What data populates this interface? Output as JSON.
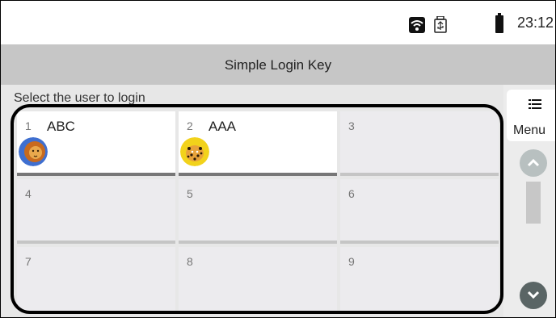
{
  "status_bar": {
    "time": "23:12",
    "wifi_icon": "wifi-icon",
    "usb_icon": "usb-icon",
    "battery_icon": "battery-icon"
  },
  "header": {
    "title": "Simple Login Key"
  },
  "instruction": "Select the user to login",
  "users": [
    {
      "number": "1",
      "name": "ABC",
      "avatar": "lion-avatar"
    },
    {
      "number": "2",
      "name": "AAA",
      "avatar": "leopard-avatar"
    },
    {
      "number": "3",
      "name": ""
    },
    {
      "number": "4",
      "name": ""
    },
    {
      "number": "5",
      "name": ""
    },
    {
      "number": "6",
      "name": ""
    },
    {
      "number": "7",
      "name": ""
    },
    {
      "number": "8",
      "name": ""
    },
    {
      "number": "9",
      "name": ""
    }
  ],
  "side_panel": {
    "menu_label": "Menu",
    "menu_icon": "list-icon",
    "scroll_up_icon": "chevron-up-icon",
    "scroll_down_icon": "chevron-down-icon"
  },
  "colors": {
    "title_bar": "#c6c6c6",
    "cell_bg": "#ecebee",
    "selected_cell_bg": "#ffffff"
  }
}
